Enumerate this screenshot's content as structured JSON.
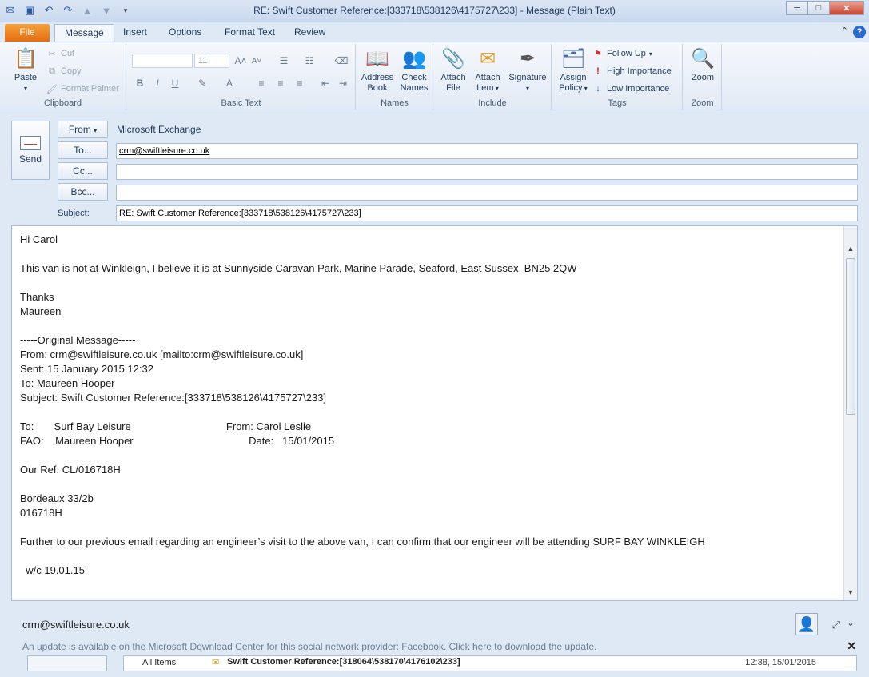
{
  "window": {
    "title": "RE: Swift Customer Reference:[333718\\538126\\4175727\\233]  -  Message (Plain Text)",
    "minimize": "─",
    "maximize": "□",
    "close": "✕"
  },
  "qat": [
    "save",
    "undo",
    "redo",
    "up",
    "down",
    "customize"
  ],
  "tabs": {
    "file": "File",
    "items": [
      "Message",
      "Insert",
      "Options",
      "Format Text",
      "Review"
    ],
    "help": "?",
    "collapse": "⌃"
  },
  "ribbon": {
    "clipboard": {
      "label": "Clipboard",
      "paste": "Paste",
      "cut": "Cut",
      "copy": "Copy",
      "format_painter": "Format Painter"
    },
    "basic_text": {
      "label": "Basic Text",
      "font_size": "11",
      "bold": "B",
      "italic": "I",
      "underline": "U",
      "grow": "A",
      "shrink": "A"
    },
    "names": {
      "label": "Names",
      "address_book": "Address Book",
      "check_names": "Check Names"
    },
    "include": {
      "label": "Include",
      "attach_file": "Attach File",
      "attach_item": "Attach Item",
      "signature": "Signature"
    },
    "tags": {
      "label": "Tags",
      "assign_policy": "Assign Policy",
      "follow_up": "Follow Up",
      "high_importance": "High Importance",
      "low_importance": "Low Importance"
    },
    "zoom": {
      "label": "Zoom",
      "zoom": "Zoom"
    }
  },
  "header": {
    "send": "Send",
    "from_btn": "From",
    "from_value": "Microsoft Exchange",
    "to_btn": "To...",
    "to_value": "crm@swiftleisure.co.uk",
    "cc_btn": "Cc...",
    "cc_value": "",
    "bcc_btn": "Bcc...",
    "bcc_value": "",
    "subject_label": "Subject:",
    "subject_value": "RE: Swift Customer Reference:[333718\\538126\\4175727\\233]"
  },
  "body": {
    "lines": [
      "Hi Carol",
      "",
      "This van is not at Winkleigh, I believe it is at Sunnyside Caravan Park, Marine Parade, Seaford, East Sussex, BN25 2QW",
      "",
      "Thanks",
      "Maureen",
      "",
      "-----Original Message-----",
      "From: crm@swiftleisure.co.uk [mailto:crm@swiftleisure.co.uk]",
      "Sent: 15 January 2015 12:32",
      "To: Maureen Hooper",
      "Subject: Swift Customer Reference:[333718\\538126\\4175727\\233]",
      "",
      "To:       Surf Bay Leisure                                 From: Carol Leslie",
      "FAO:    Maureen Hooper                                        Date:   15/01/2015",
      "",
      "Our Ref: CL/016718H",
      "",
      "Bordeaux 33/2b",
      "016718H",
      "",
      "Further to our previous email regarding an engineer’s visit to the above van, I can confirm that our engineer will be attending SURF BAY WINKLEIGH",
      "",
      "  w/c 19.01.15"
    ]
  },
  "people_pane": {
    "email": "crm@swiftleisure.co.uk",
    "notice": "An update is available on the Microsoft Download Center for this social network provider: Facebook. Click here to download the update.",
    "all_items": "All Items",
    "item_subject": "Swift Customer Reference:[318064\\538170\\4176102\\233]",
    "item_time": "12:38, 15/01/2015"
  }
}
